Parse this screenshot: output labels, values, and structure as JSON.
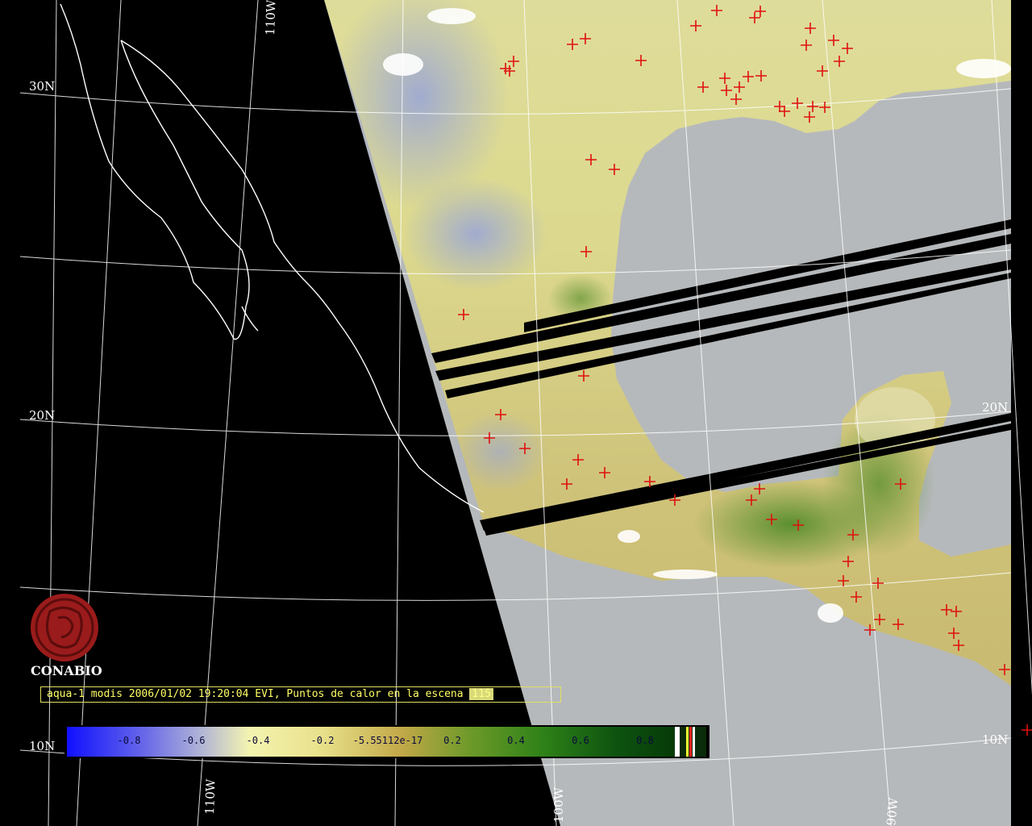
{
  "grid": {
    "longitude_labels": [
      "110W",
      "110W",
      "100W",
      "90W"
    ],
    "latitude_labels": [
      "30N",
      "20N",
      "10N",
      "20N",
      "10N"
    ]
  },
  "logo": {
    "name": "CONABIO"
  },
  "caption": {
    "text": "aqua-1 modis 2006/01/02 19:20:04 EVI, Puntos de calor en la escena ",
    "hotspot_count": "115"
  },
  "colorbar": {
    "labels": [
      "-0.8",
      "-0.6",
      "-0.4",
      "-0.2",
      "-5.55112e-17",
      "0.2",
      "0.4",
      "0.6",
      "0.8"
    ]
  },
  "colors": {
    "background": "#000000",
    "ocean": "#b6b9bb",
    "gridline": "#ffffff",
    "hotspot": "#e01010",
    "caption": "#ffff66",
    "logo": "#9a1b1b"
  }
}
